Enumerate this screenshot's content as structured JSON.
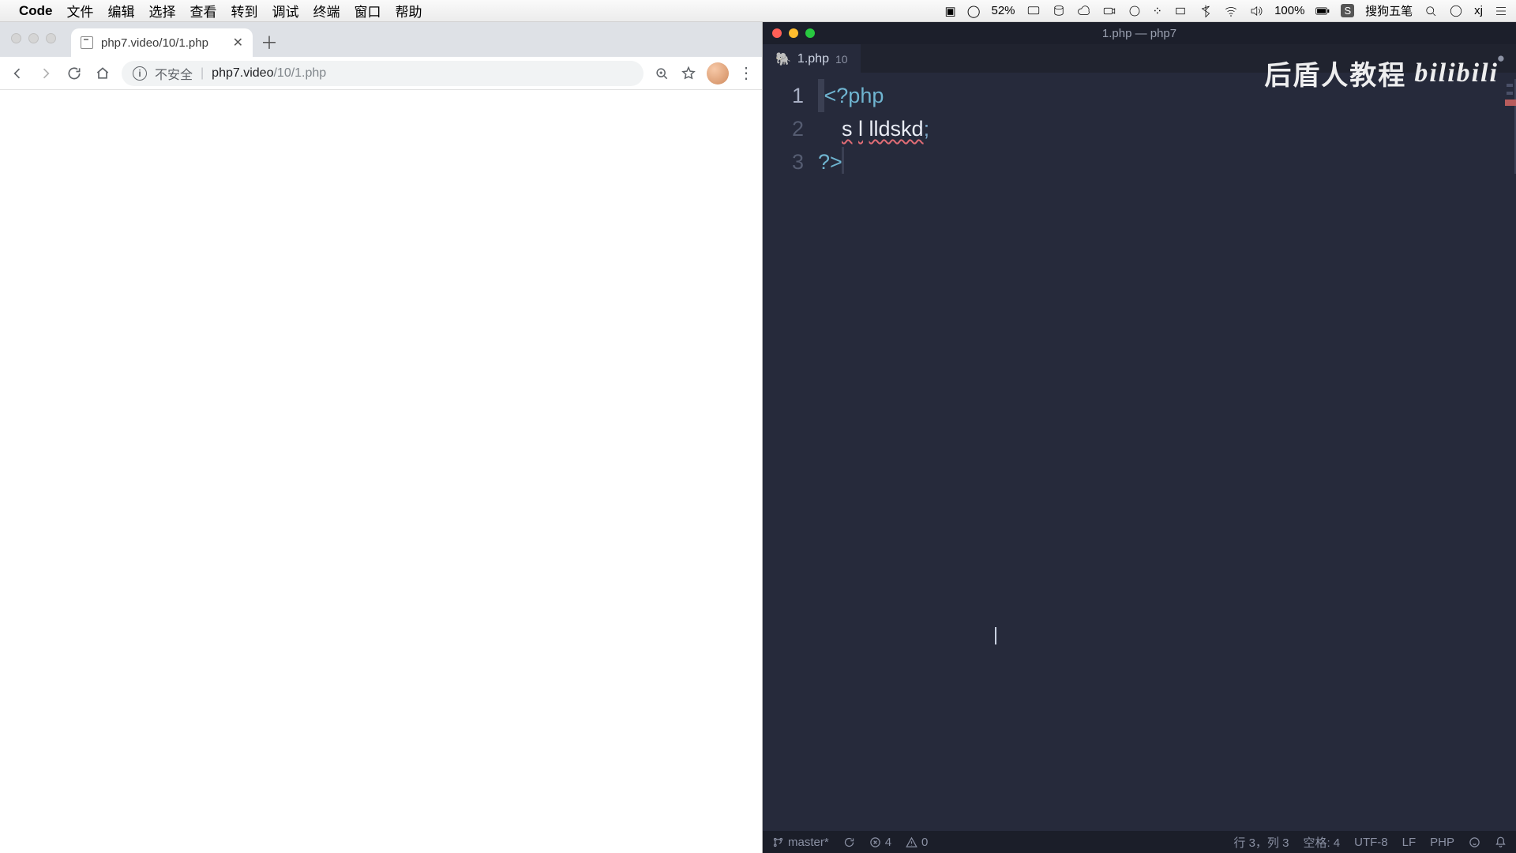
{
  "menubar": {
    "app_name": "Code",
    "items": [
      "文件",
      "编辑",
      "选择",
      "查看",
      "转到",
      "调试",
      "终端",
      "窗口",
      "帮助"
    ],
    "battery_pct": "52%",
    "ime": "搜狗五笔",
    "user": "xj"
  },
  "chrome": {
    "tab_title": "php7.video/10/1.php",
    "not_secure_label": "不安全",
    "url_host": "php7.video",
    "url_path": "/10/1.php"
  },
  "vscode": {
    "window_title": "1.php — php7",
    "tab_filename": "1.php",
    "tab_error_count": "10",
    "code_lines": {
      "l1": "<?php",
      "l2_indent": "    ",
      "l2_a": "s",
      "l2_b": "l",
      "l2_c": "lldskd",
      "l2_semi": ";",
      "l3": "?>"
    },
    "line_numbers": [
      "1",
      "2",
      "3"
    ],
    "status": {
      "branch": "master*",
      "errors": "4",
      "warnings": "0",
      "cursor_pos": "行 3，列 3",
      "spaces": "空格: 4",
      "encoding": "UTF-8",
      "eol": "LF",
      "lang": "PHP"
    }
  },
  "watermark": {
    "cn": "后盾人教程",
    "brand": "bilibili"
  }
}
